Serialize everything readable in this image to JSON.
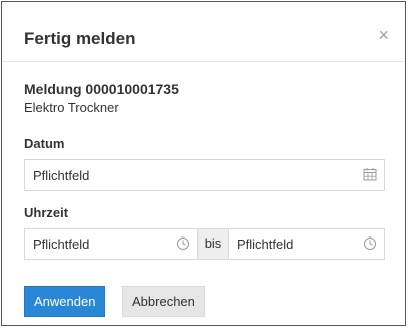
{
  "dialog": {
    "title": "Fertig melden",
    "close_glyph": "×"
  },
  "message": {
    "title": "Meldung 000010001735",
    "subtitle": "Elektro Trockner"
  },
  "date": {
    "label": "Datum",
    "placeholder": "Pflichtfeld",
    "icon": "calendar-icon"
  },
  "time": {
    "label": "Uhrzeit",
    "from_placeholder": "Pflichtfeld",
    "separator": "bis",
    "to_placeholder": "Pflichtfeld",
    "icon": "clock-icon"
  },
  "actions": {
    "apply_label": "Anwenden",
    "cancel_label": "Abbrechen"
  },
  "colors": {
    "primary": "#2a86d6",
    "secondary": "#e6e6e6",
    "icon": "#9a9a9a"
  }
}
